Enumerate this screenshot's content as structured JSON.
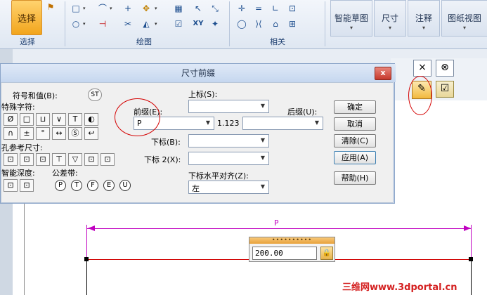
{
  "ribbon": {
    "select_label": "选择",
    "groups": {
      "select": "选择",
      "draw": "绘图",
      "related": "相关"
    },
    "big_buttons": {
      "smart_sketch": "智能草图",
      "dimension": "尺寸",
      "annotation": "注释",
      "drawing_view": "图纸视图"
    },
    "xy_label": "XY"
  },
  "dialog": {
    "title": "尺寸前缀",
    "close_label": "x",
    "symbols_label": "符号和值(B):",
    "special_chars_label": "特殊字符:",
    "hole_ref_label": "孔参考尺寸:",
    "smart_depth_label": "智能深度:",
    "tolerance_band_label": "公差带:",
    "superscript_label": "上标(S):",
    "prefix_label": "前缀(E):",
    "prefix_value": "P",
    "sample_value": "1.123",
    "suffix_label": "后缀(U):",
    "subscript_label": "下标(B):",
    "subscript2_label": "下标 2(X):",
    "sub_align_label": "下标水平对齐(Z):",
    "sub_align_value": "左",
    "special_symbols": [
      "Ø",
      "□",
      "⊔",
      "∨",
      "T",
      "◐",
      "∩",
      "±",
      "°",
      "↔",
      "Ⓢ",
      "↩"
    ],
    "tolerance_symbols": [
      "P",
      "T",
      "F",
      "E",
      "U"
    ],
    "buttons": {
      "ok": "确定",
      "cancel": "取消",
      "clear": "清除(C)",
      "apply": "应用(A)",
      "help": "帮助(H)"
    }
  },
  "drawing": {
    "dim_label": "P",
    "edit_value": "200.00",
    "edit_grip": "••••••••••"
  },
  "canvas_toolbar": {
    "close": "×",
    "cancel": "⊗"
  },
  "watermark": "三维网www.3dportal.cn",
  "colors": {
    "dimension": "#c000c0",
    "geometry": "#d00000",
    "highlight": "#f2a51d",
    "annotation": "#d40000"
  }
}
